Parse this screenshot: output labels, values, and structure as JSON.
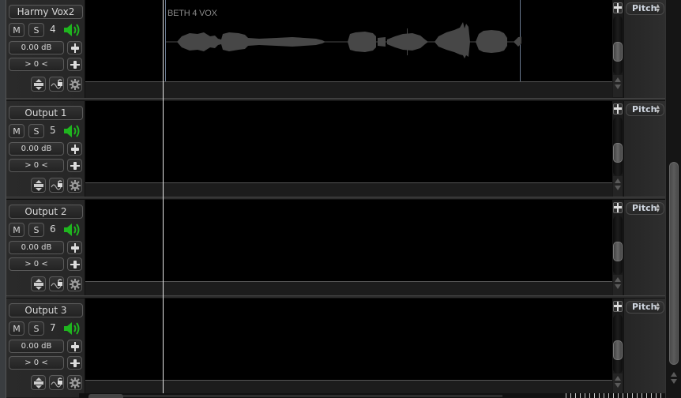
{
  "tracks": [
    {
      "name": "Harmy Vox2",
      "mute_label": "M",
      "solo_label": "S",
      "number": "4",
      "volume": "0.00 dB",
      "pan": "> 0 <",
      "parameter": "Pitch",
      "region": {
        "label": "BETH 4 VOX"
      }
    },
    {
      "name": "Output 1",
      "mute_label": "M",
      "solo_label": "S",
      "number": "5",
      "volume": "0.00 dB",
      "pan": "> 0 <",
      "parameter": "Pitch"
    },
    {
      "name": "Output 2",
      "mute_label": "M",
      "solo_label": "S",
      "number": "6",
      "volume": "0.00 dB",
      "pan": "> 0 <",
      "parameter": "Pitch"
    },
    {
      "name": "Output 3",
      "mute_label": "M",
      "solo_label": "S",
      "number": "7",
      "volume": "0.00 dB",
      "pan": "> 0 <",
      "parameter": "Pitch"
    }
  ],
  "icons": {
    "speaker": "speaker-icon",
    "fader": "fader-icon",
    "pan": "pan-icon",
    "track_height": "track-height-icon",
    "automation_lock": "automation-lock-icon",
    "settings": "gear-icon"
  },
  "colors": {
    "speaker_active": "#1fb51f",
    "waveform": "#474747",
    "region_border": "#6a7a90",
    "playhead": "#e8e8e8"
  }
}
